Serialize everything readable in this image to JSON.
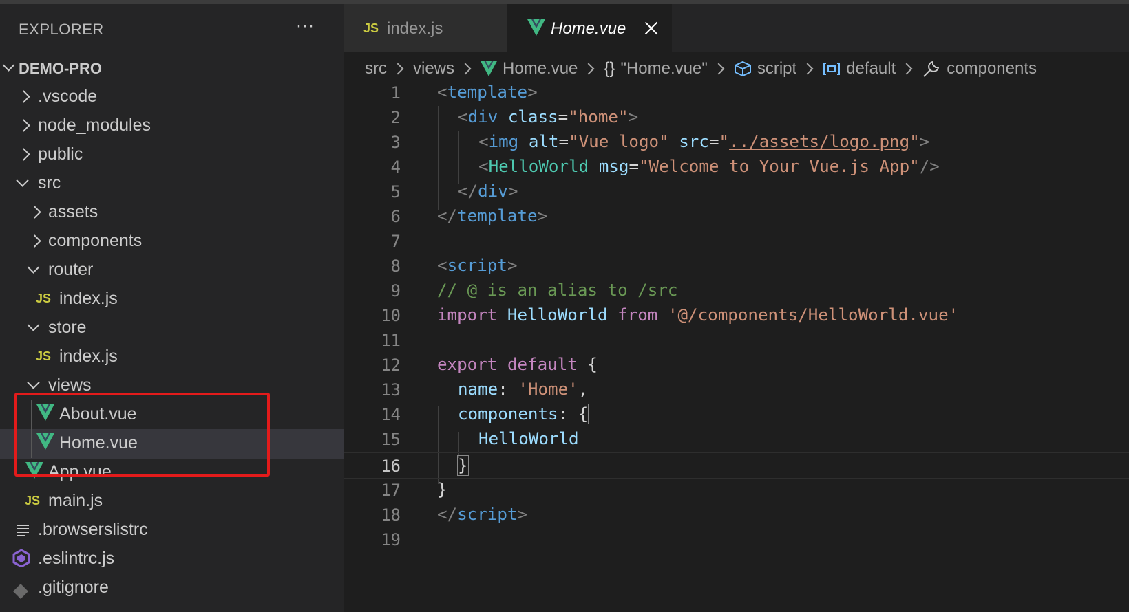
{
  "sidebar": {
    "title": "EXPLORER",
    "more_label": "···",
    "root": "DEMO-PRO",
    "items": [
      {
        "label": ".vscode"
      },
      {
        "label": "node_modules"
      },
      {
        "label": "public"
      },
      {
        "label": "src"
      },
      {
        "label": "assets"
      },
      {
        "label": "components"
      },
      {
        "label": "router"
      },
      {
        "label": "index.js",
        "icon": "JS"
      },
      {
        "label": "store"
      },
      {
        "label": "index.js",
        "icon": "JS"
      },
      {
        "label": "views"
      },
      {
        "label": "About.vue"
      },
      {
        "label": "Home.vue"
      },
      {
        "label": "App.vue"
      },
      {
        "label": "main.js",
        "icon": "JS"
      },
      {
        "label": ".browserslistrc"
      },
      {
        "label": ".eslintrc.js"
      },
      {
        "label": ".gitignore"
      }
    ]
  },
  "tabs": [
    {
      "label": "index.js",
      "icon": "JS"
    },
    {
      "label": "Home.vue"
    }
  ],
  "breadcrumb": [
    "src",
    "views",
    "Home.vue",
    "\"Home.vue\"",
    "script",
    "default",
    "components"
  ],
  "breadcrumb_braces": "{}",
  "editor": {
    "line_numbers": [
      "1",
      "2",
      "3",
      "4",
      "5",
      "6",
      "7",
      "8",
      "9",
      "10",
      "11",
      "12",
      "13",
      "14",
      "15",
      "16",
      "17",
      "18",
      "19"
    ],
    "current_line": "16"
  },
  "code": {
    "l1": {
      "a": "<",
      "b": "template",
      "c": ">"
    },
    "l2": {
      "a": "<",
      "b": "div",
      "c": " ",
      "d": "class",
      "e": "=",
      "f": "\"home\"",
      "g": ">"
    },
    "l3": {
      "a": "<",
      "b": "img",
      "c": " ",
      "d": "alt",
      "e": "=",
      "f": "\"Vue logo\"",
      "g": " ",
      "h": "src",
      "i": "=",
      "j": "\"",
      "k": "../assets/logo.png",
      "l": "\"",
      "m": ">"
    },
    "l4": {
      "a": "<",
      "b": "HelloWorld",
      "c": " ",
      "d": "msg",
      "e": "=",
      "f": "\"Welcome to Your Vue.js App\"",
      "g": "/>"
    },
    "l5": {
      "a": "</",
      "b": "div",
      "c": ">"
    },
    "l6": {
      "a": "</",
      "b": "template",
      "c": ">"
    },
    "l8": {
      "a": "<",
      "b": "script",
      "c": ">"
    },
    "l9": {
      "a": "// @ is an alias to /src"
    },
    "l10": {
      "a": "import",
      "b": " HelloWorld ",
      "c": "from",
      "d": " ",
      "e": "'@/components/HelloWorld.vue'"
    },
    "l12": {
      "a": "export",
      "b": " ",
      "c": "default",
      "d": " {"
    },
    "l13": {
      "a": "name",
      "b": ": ",
      "c": "'Home'",
      "d": ","
    },
    "l14": {
      "a": "components",
      "b": ": ",
      "c": "{"
    },
    "l15": {
      "a": "HelloWorld"
    },
    "l16": {
      "a": "}"
    },
    "l17": {
      "a": "}"
    },
    "l18": {
      "a": "</",
      "b": "script",
      "c": ">"
    }
  },
  "colors": {
    "editor_bg": "#1e1e1e",
    "sidebar_bg": "#252526",
    "highlight_box": "#e31b1b",
    "vue_green": "#41b883",
    "js_yellow": "#cbcb41"
  }
}
